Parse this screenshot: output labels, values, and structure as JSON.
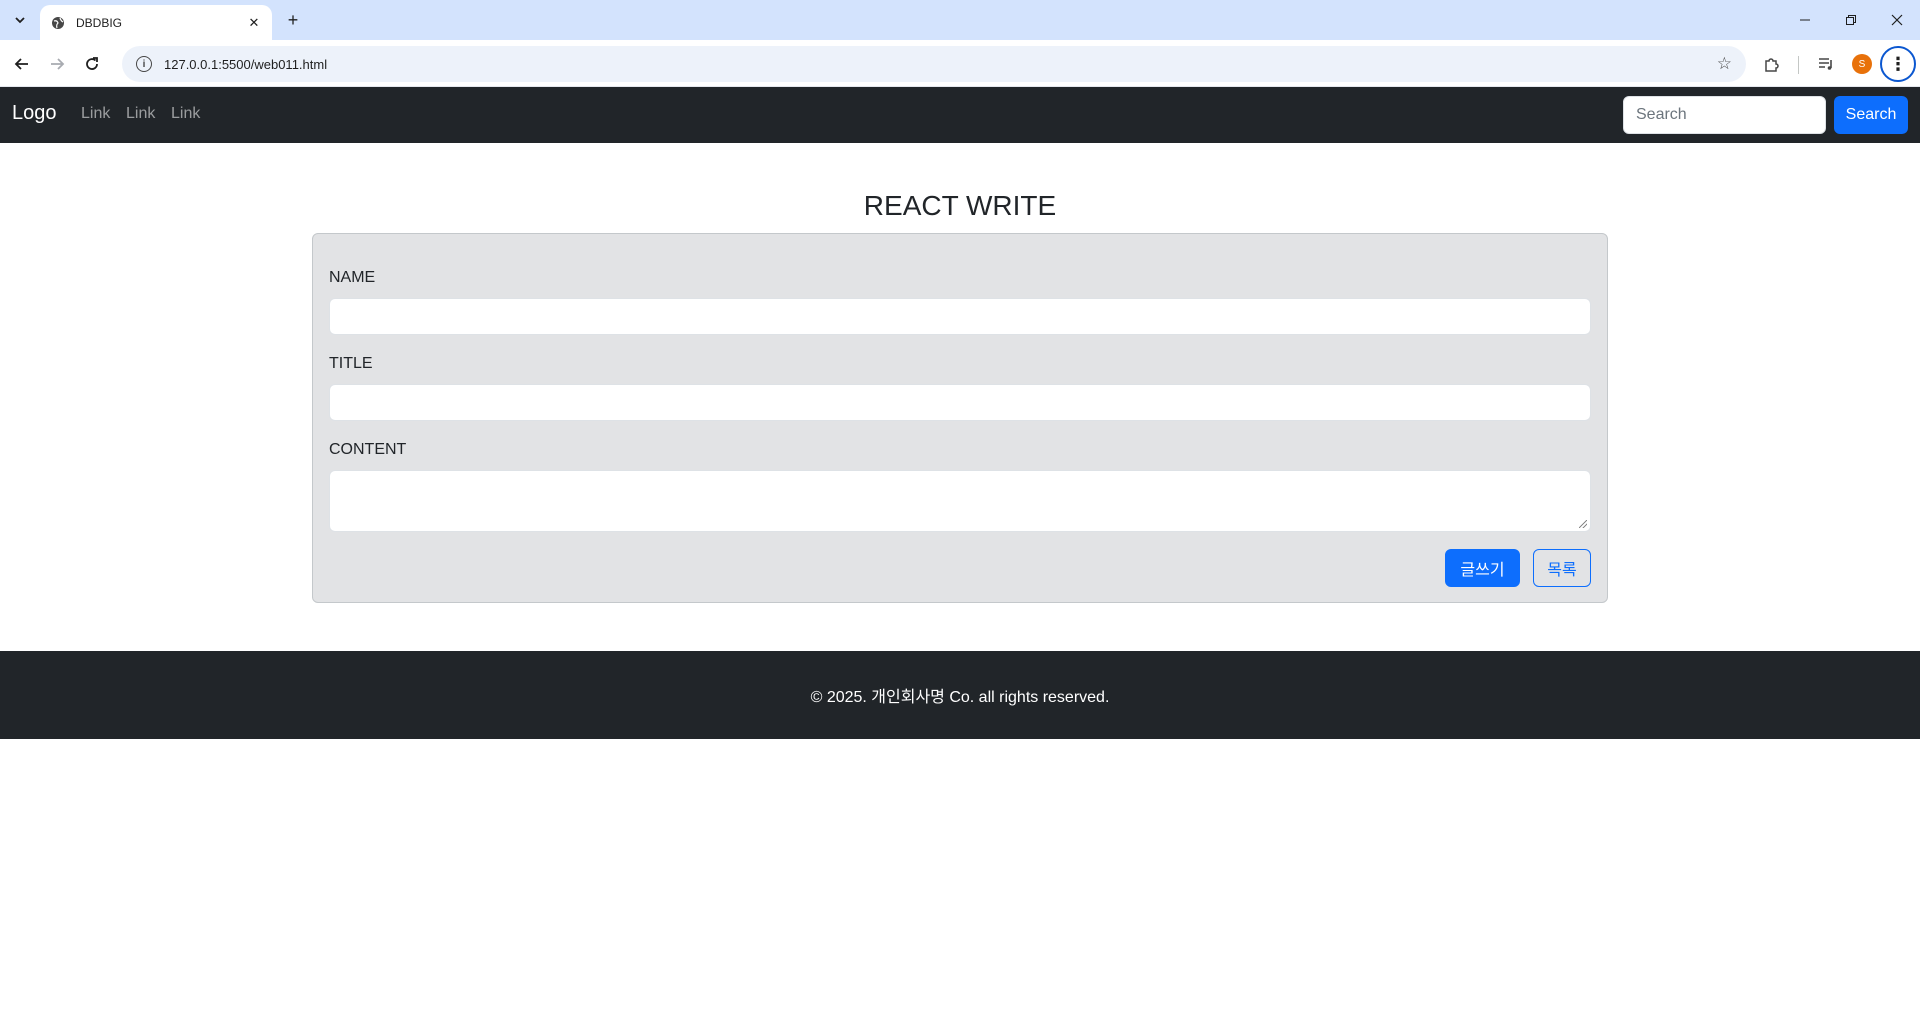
{
  "browser": {
    "tab_title": "DBDBIG",
    "url": "127.0.0.1:5500/web011.html",
    "profile_initial": "S"
  },
  "navbar": {
    "brand": "Logo",
    "links": [
      "Link",
      "Link",
      "Link"
    ],
    "search_placeholder": "Search",
    "search_button": "Search",
    "bg_color": "#212529"
  },
  "main": {
    "title": "REACT WRITE",
    "fields": {
      "name_label": "NAME",
      "name_value": "",
      "title_label": "TITLE",
      "title_value": "",
      "content_label": "CONTENT",
      "content_value": ""
    },
    "buttons": {
      "write": "글쓰기",
      "list": "목록"
    },
    "accent_color": "#0d6efd"
  },
  "footer": {
    "text": "© 2025. 개인회사명 Co. all rights reserved."
  }
}
